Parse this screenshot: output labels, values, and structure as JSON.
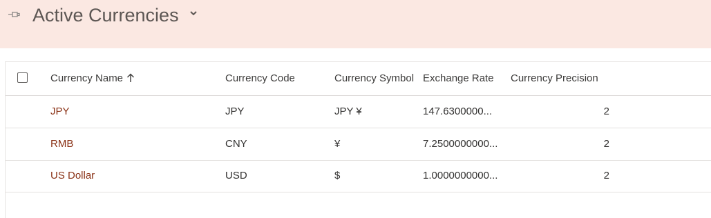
{
  "header": {
    "title": "Active Currencies",
    "pin_icon": "pin-icon",
    "chevron_icon": "chevron-down-icon"
  },
  "grid": {
    "columns": {
      "name": "Currency Name",
      "code": "Currency Code",
      "symbol": "Currency Symbol",
      "rate": "Exchange Rate",
      "precision": "Currency Precision"
    },
    "sort_icon": "arrow-up-icon",
    "rows": [
      {
        "name": "JPY",
        "code": "JPY",
        "symbol": "JPY ¥",
        "rate": "147.6300000...",
        "precision": "2"
      },
      {
        "name": "RMB",
        "code": "CNY",
        "symbol": "¥",
        "rate": "7.2500000000...",
        "precision": "2"
      },
      {
        "name": "US Dollar",
        "code": "USD",
        "symbol": "$",
        "rate": "1.0000000000...",
        "precision": "2"
      }
    ]
  },
  "colors": {
    "header_bg": "#fbe8e2",
    "link": "#8a3216",
    "text": "#323130"
  }
}
